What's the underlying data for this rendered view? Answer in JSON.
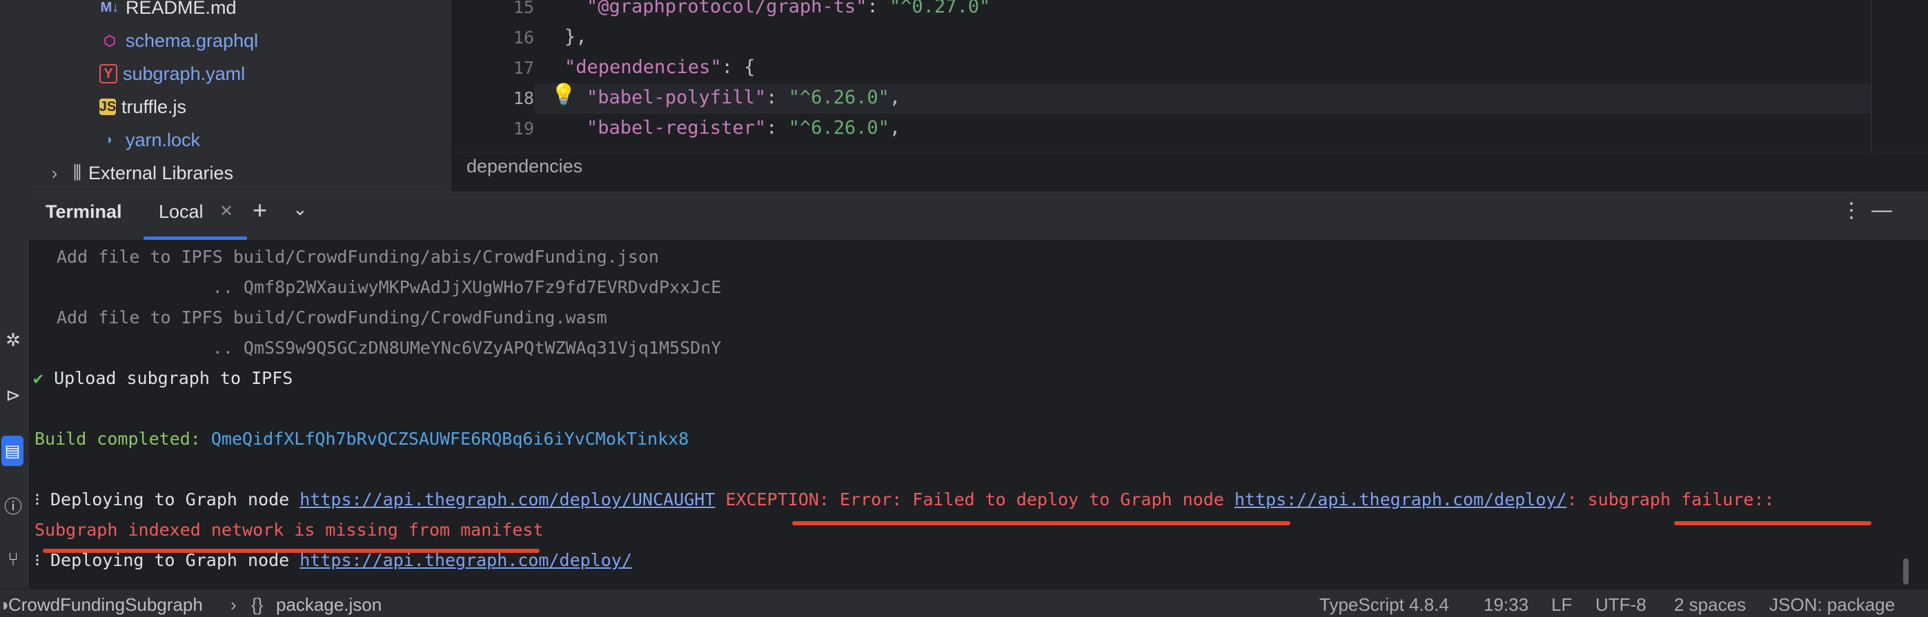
{
  "project_tree": {
    "items": [
      {
        "icon": "markdown-icon",
        "label": "README.md"
      },
      {
        "icon": "graphql-icon",
        "label": "schema.graphql"
      },
      {
        "icon": "yaml-icon",
        "label": "subgraph.yaml"
      },
      {
        "icon": "javascript-icon",
        "label": "truffle.js"
      },
      {
        "icon": "yarn-icon",
        "label": "yarn.lock"
      }
    ],
    "external_libraries": "External Libraries",
    "icon_glyphs": {
      "md": "M↓",
      "gql": "⬡",
      "yaml": "Y",
      "js": "JS",
      "yarn": "🐈",
      "lib": "⫼",
      "chevron": "›"
    }
  },
  "editor": {
    "line_numbers": [
      "15",
      "16",
      "17",
      "18",
      "19"
    ],
    "current_line": "18",
    "lines": [
      {
        "key": "\"@graphprotocol/graph-ts\"",
        "sep": ": ",
        "value": "\"^0.27.0\"",
        "end": ""
      },
      {
        "punct": "},"
      },
      {
        "key": "\"dependencies\"",
        "sep": ": ",
        "punct_after": "{"
      },
      {
        "key": "\"babel-polyfill\"",
        "sep": ": ",
        "value": "\"^6.26.0\"",
        "end": ","
      },
      {
        "key": "\"babel-register\"",
        "sep": ": ",
        "value": "\"^6.26.0\"",
        "end": ","
      }
    ],
    "breadcrumb": "dependencies"
  },
  "terminal": {
    "title": "Terminal",
    "tab_label": "Local",
    "output": {
      "l1": "Add file to IPFS build/CrowdFunding/abis/CrowdFunding.json",
      "l2": "               .. Qmf8p2WXauiwyMKPwAdJjXUgWHo7Fz9fd7EVRDvdPxxJcE",
      "l3": "Add file to IPFS build/CrowdFunding/CrowdFunding.wasm",
      "l4": "               .. QmSS9w9Q5GCzDN8UMeYNc6VZyAPQtWZWAq31Vjq1M5SDnY",
      "l5_check": "✔",
      "l5": " Upload subgraph to IPFS",
      "l6_label": "Build completed: ",
      "l6_hash": "QmeQidfXLfQh7bRvQCZSAUWFE6RQBq6i6iYvCMokTinkx8",
      "l7_prefix": "⁝ Deploying to Graph node ",
      "l7_link": "https://api.thegraph.com/deploy/UNCAUGHT",
      "l7_err": " EXCEPTION: Error: Failed to deploy to Graph node ",
      "l7_link2": "https://api.thegraph.com/deploy/",
      "l7_tail": ": subgraph failure::",
      "l8": "Subgraph indexed network is missing from manifest",
      "l9_prefix": "⁝ Deploying to Graph node ",
      "l9_link": "https://api.thegraph.com/deploy/"
    }
  },
  "status_bar": {
    "project": "CrowdFundingSubgraph",
    "separator": "›",
    "file_icon": "{}",
    "file": "package.json",
    "language": "TypeScript 4.8.4",
    "position": "19:33",
    "line_ending": "LF",
    "encoding": "UTF-8",
    "indent": "2 spaces",
    "schema": "JSON: package"
  },
  "colors": {
    "accent": "#3574f0",
    "error": "#ef5b5b",
    "annotation": "#e2452b"
  }
}
